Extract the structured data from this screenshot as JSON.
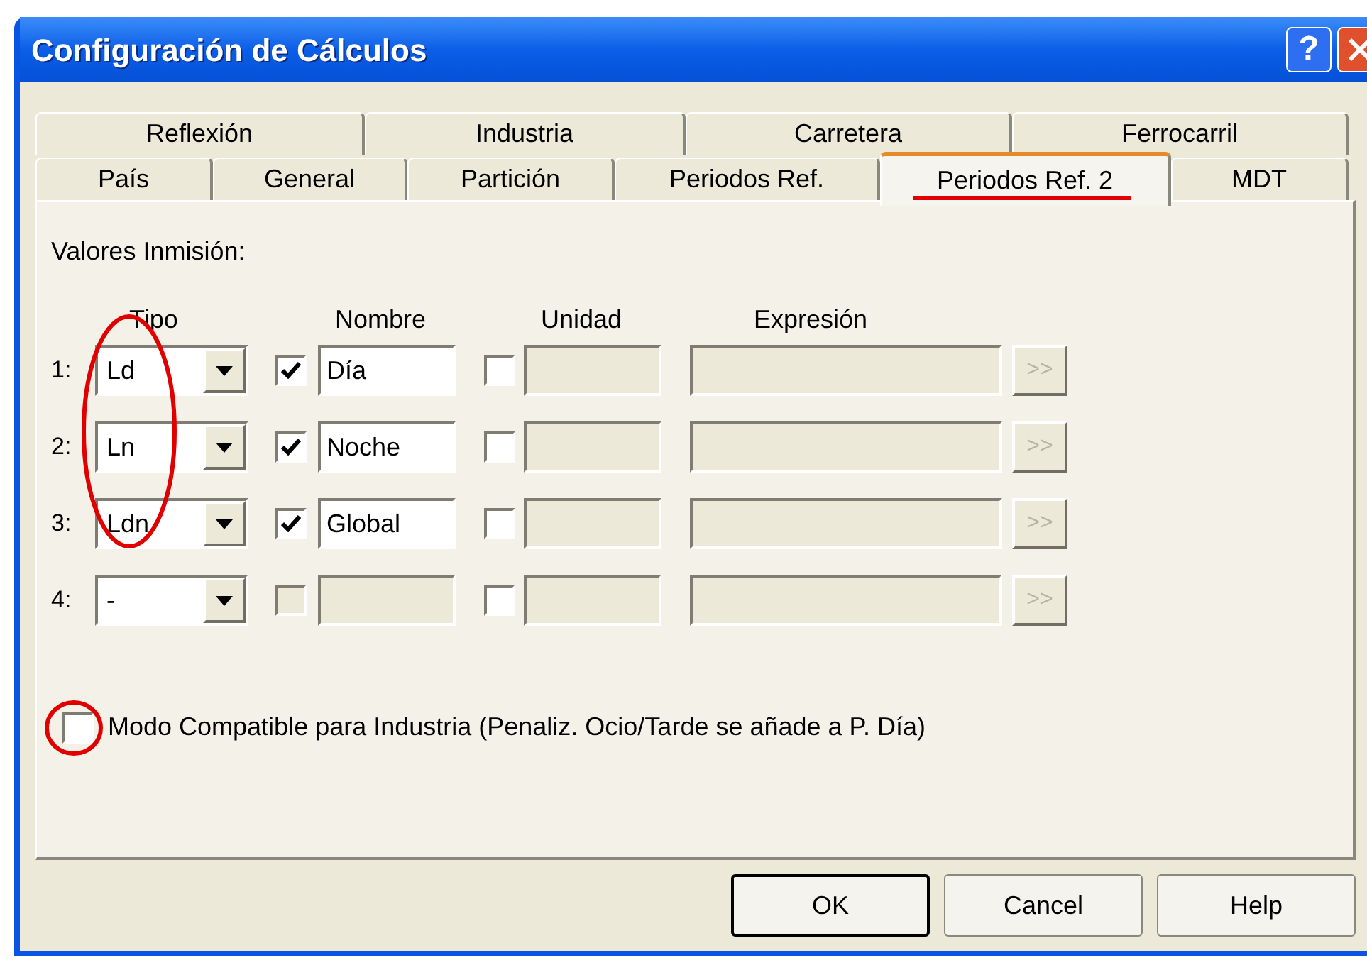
{
  "window": {
    "title": "Configuración de Cálculos",
    "help_button": "?"
  },
  "tab_rows": [
    [
      {
        "label": "Reflexión",
        "selected": false
      },
      {
        "label": "Industria",
        "selected": false
      },
      {
        "label": "Carretera",
        "selected": false
      },
      {
        "label": "Ferrocarril",
        "selected": false
      }
    ],
    [
      {
        "label": "País",
        "selected": false
      },
      {
        "label": "General",
        "selected": false
      },
      {
        "label": "Partición",
        "selected": false
      },
      {
        "label": "Periodos Ref.",
        "selected": false
      },
      {
        "label": "Periodos Ref. 2",
        "selected": true
      },
      {
        "label": "MDT",
        "selected": false
      }
    ]
  ],
  "section_label": "Valores Inmisión:",
  "columns": [
    "Tipo",
    "Nombre",
    "Unidad",
    "Expresión"
  ],
  "rows": [
    {
      "number": "1:",
      "tipo": "Ld",
      "name_checked": true,
      "name": "Día",
      "disabled": false,
      "unit_checked": false,
      "expr_button": ">>"
    },
    {
      "number": "2:",
      "tipo": "Ln",
      "name_checked": true,
      "name": "Noche",
      "disabled": false,
      "unit_checked": false,
      "expr_button": ">>"
    },
    {
      "number": "3:",
      "tipo": "Ldn",
      "name_checked": true,
      "name": "Global",
      "disabled": false,
      "unit_checked": false,
      "expr_button": ">>"
    },
    {
      "number": "4:",
      "tipo": "-",
      "name_checked": false,
      "disabled": true,
      "unit_checked": false,
      "expr_button": ">>"
    }
  ],
  "compat": {
    "label": "Modo Compatible para Industria (Penaliz. Ocio/Tarde se añade a P. Día)",
    "checked": false
  },
  "buttons": [
    {
      "label": "OK",
      "default": true
    },
    {
      "label": "Cancel",
      "default": false
    },
    {
      "label": "Help",
      "default": false
    }
  ]
}
